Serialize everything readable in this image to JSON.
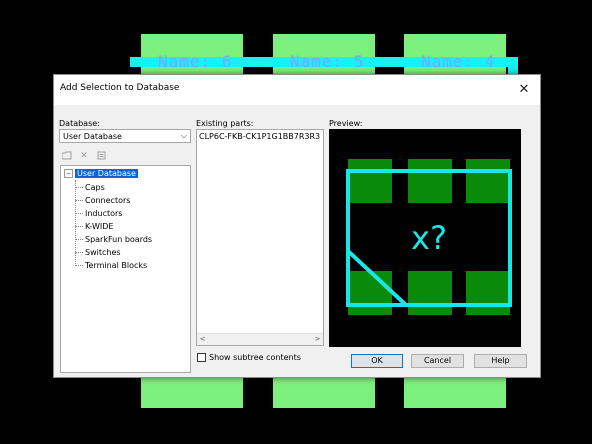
{
  "background": {
    "pad_labels": [
      "Name: 6",
      "Name: 5",
      "Name: 4"
    ],
    "colors": {
      "pad": "#7cf07c",
      "outline": "#19f0f0",
      "label": "#7aa8ff"
    }
  },
  "dialog": {
    "title": "Add Selection to Database",
    "close_glyph": "✕",
    "database_label": "Database:",
    "database_value": "User Database",
    "toolbar_icons": [
      "new-folder-icon",
      "delete-icon",
      "properties-icon"
    ],
    "tree": {
      "root": "User Database",
      "children": [
        "Caps",
        "Connectors",
        "Inductors",
        "K-WIDE",
        "SparkFun boards",
        "Switches",
        "Terminal Blocks"
      ]
    },
    "existing_parts_label": "Existing parts:",
    "existing_parts": [
      "CLP6C-FKB-CK1P1G1BB7R3R3"
    ],
    "show_subtree_label": "Show subtree contents",
    "preview_label": "Preview:",
    "preview_marker": "x?",
    "buttons": {
      "ok": "OK",
      "cancel": "Cancel",
      "help": "Help"
    },
    "colors": {
      "accent": "#0078d7",
      "selection": "#0a64d8",
      "preview_pad": "#0a8a0a",
      "preview_outline": "#19e6e6"
    }
  }
}
